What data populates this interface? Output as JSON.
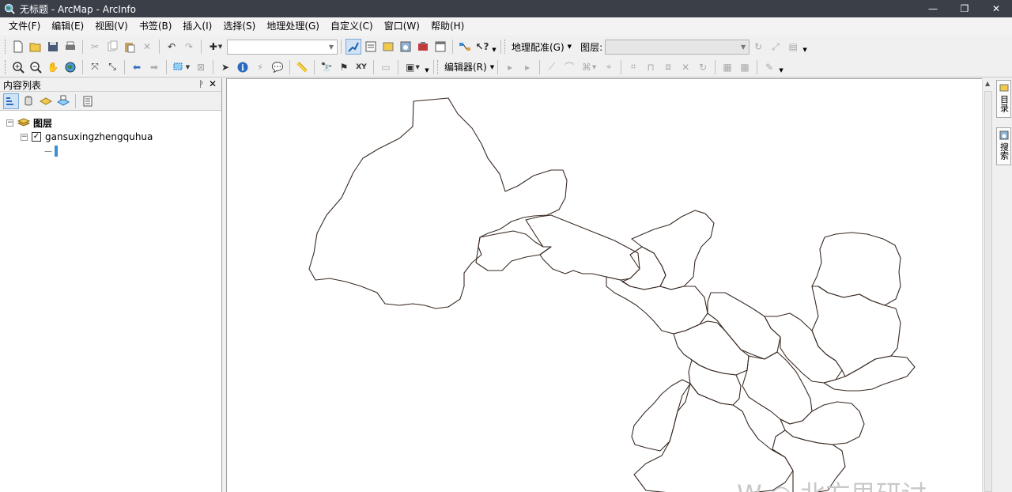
{
  "window": {
    "title": "无标题 - ArcMap - ArcInfo",
    "minimize": "—",
    "maximize": "❐",
    "close": "✕"
  },
  "menu": [
    "文件(F)",
    "编辑(E)",
    "视图(V)",
    "书签(B)",
    "插入(I)",
    "选择(S)",
    "地理处理(G)",
    "自定义(C)",
    "窗口(W)",
    "帮助(H)"
  ],
  "toolbar1": {
    "georef_label": "地理配准(G)",
    "layer_label": "图层:",
    "scale_value": "",
    "layer_value": ""
  },
  "toolbar2": {
    "editor_label": "编辑器(R)"
  },
  "toc": {
    "title": "内容列表",
    "pin": "ᚹ",
    "close": "✕",
    "root_label": "图层",
    "layer_name": "gansuxingzhengquhua",
    "legend_line": "—"
  },
  "right_dock": {
    "tab1": "目录",
    "tab2": "搜索"
  },
  "watermark": "W  ◎ 北方思研讨",
  "colors": {
    "titlebar": "#3a3f48",
    "boundary": "#3a2a22",
    "legend_accent": "#3b8fd6"
  }
}
